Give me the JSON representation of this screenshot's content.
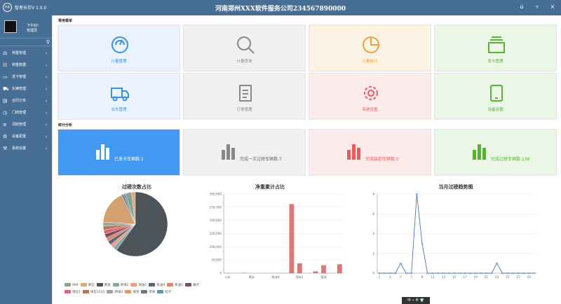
{
  "titlebar": {
    "logo_text": "称重",
    "app_title": "智者长存V 1.0.0",
    "company": "河南郑州XXX软件服务公司234567890000",
    "icons": [
      "home-icon",
      "shirt-icon",
      "close-icon"
    ]
  },
  "sidebar": {
    "greeting": "下午好!",
    "role": "管理员",
    "menu": [
      {
        "label": "称重管理",
        "icon": "scale-icon"
      },
      {
        "label": "称重数据",
        "icon": "chart-icon"
      },
      {
        "label": "发卡管理",
        "icon": "card-icon"
      },
      {
        "label": "车辆管理",
        "icon": "truck-icon"
      },
      {
        "label": "合同订单",
        "icon": "doc-icon"
      },
      {
        "label": "门岗管理",
        "icon": "clock-icon"
      },
      {
        "label": "词组管理",
        "icon": "list-icon"
      },
      {
        "label": "设备配置",
        "icon": "device-icon"
      },
      {
        "label": "系统设置",
        "icon": "wrench-icon"
      }
    ]
  },
  "sections": {
    "common": "常用菜单",
    "stats": "统计分析"
  },
  "cards": [
    {
      "label": "计量管理",
      "icon": "gauge-icon",
      "bg": "#eaf3fd",
      "color": "#3d8fe0"
    },
    {
      "label": "计量查询",
      "icon": "search-icon",
      "bg": "#f0f0f0",
      "color": "#888888"
    },
    {
      "label": "计量统计",
      "icon": "pie-icon",
      "bg": "#fdf3e4",
      "color": "#e8a33d"
    },
    {
      "label": "发卡管理",
      "icon": "stack-icon",
      "bg": "#ebf6e6",
      "color": "#58b234"
    },
    {
      "label": "派车管理",
      "icon": "truck-icon",
      "bg": "#eaf3fd",
      "color": "#3d8fe0"
    },
    {
      "label": "订单管理",
      "icon": "document-icon",
      "bg": "#f0f0f0",
      "color": "#888888"
    },
    {
      "label": "系统设置",
      "icon": "gear-icon",
      "bg": "#fdeaea",
      "color": "#e85c5c"
    },
    {
      "label": "设备设置",
      "icon": "tablet-icon",
      "bg": "#ebf6e6",
      "color": "#58b234"
    }
  ],
  "stats": [
    {
      "label": "已发卡车辆数:1",
      "bg": "#4199f4",
      "bar": "#ffffff",
      "text": "#ffffff"
    },
    {
      "label": "完成一次过磅车辆数:7",
      "bg": "#f0f0f0",
      "bar": "#888888",
      "text": "#666666"
    },
    {
      "label": "完成装卸车辆数:0",
      "bg": "#fdeaea",
      "bar": "#e85c5c",
      "text": "#e85c5c"
    },
    {
      "label": "完成过磅车辆数:136",
      "bg": "#ebf6e6",
      "bar": "#58b234",
      "text": "#58b234"
    }
  ],
  "chart_data": [
    {
      "type": "pie",
      "title": "过磅次数占比",
      "legend_position": "bottom",
      "labels": [
        "999",
        "黄石",
        "黄金",
        "原煤2",
        "煤油1",
        "焦油4",
        "焦油5",
        "橘子",
        "煤炭1",
        "煤炭1555",
        "原煤2",
        "煤渣",
        "苹果",
        "桔子"
      ],
      "colors": [
        "#8fa08a",
        "#d8a880",
        "#4c5459",
        "#84a8a8",
        "#e8a08c",
        "#5a6670",
        "#d88870",
        "#7a5058",
        "#d86878",
        "#b87858",
        "#98a8a0",
        "#d4a070",
        "#6a7a80",
        "#5a9aa8"
      ],
      "values": [
        3,
        2,
        60,
        2,
        2,
        2,
        2,
        2,
        2,
        2,
        2,
        17,
        1,
        1
      ]
    },
    {
      "type": "bar",
      "title": "净重累计占比",
      "ylim": [
        0,
        300000
      ],
      "yticks": [
        "0",
        "50,000",
        "100,000",
        "150,000",
        "200,000",
        "250,000",
        "300,000"
      ],
      "xticks": [
        "null",
        "黄金",
        "焦油4",
        "煤炭1",
        "煤渣"
      ],
      "values": [
        1000,
        500,
        1500,
        0,
        0,
        0,
        800,
        700,
        262000,
        37000,
        0,
        7000,
        30000,
        0,
        34000
      ],
      "color": "#d97876"
    },
    {
      "type": "line",
      "title": "当月过磅趋势图",
      "ylim": [
        0,
        8
      ],
      "yticks": [
        "0",
        "2",
        "4",
        "6",
        "8"
      ],
      "x": [
        1,
        2,
        3,
        4,
        5,
        6,
        7,
        8,
        9,
        10,
        11,
        12,
        13,
        14,
        15,
        16,
        17,
        18,
        19,
        20,
        21,
        22,
        23,
        24,
        25,
        26,
        27,
        28,
        29,
        30
      ],
      "xticks": [
        "1",
        "3",
        "5",
        "7",
        "9",
        "11",
        "13",
        "15",
        "17",
        "19",
        "21",
        "23",
        "25",
        "27",
        "29"
      ],
      "values": [
        0,
        0,
        0,
        0,
        1,
        0,
        0,
        8,
        3,
        0,
        0,
        0,
        0,
        0,
        0,
        0,
        0,
        0,
        0,
        0,
        0,
        0,
        1,
        0,
        0,
        0,
        0,
        0,
        0,
        0
      ],
      "color": "#4a72c4"
    }
  ],
  "taskbar": {
    "text": "中 • 半 👕"
  }
}
